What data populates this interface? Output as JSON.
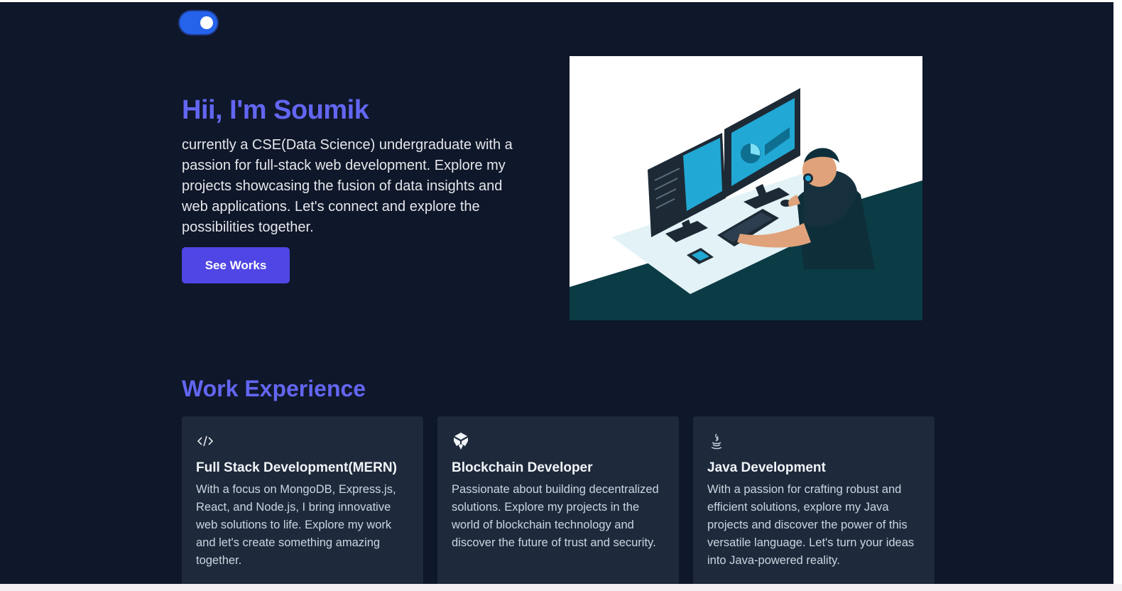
{
  "theme_toggle": {
    "state": "on"
  },
  "hero": {
    "title": "Hii, I'm Soumik",
    "description": "currently a CSE(Data Science) undergraduate with a passion for full-stack web development. Explore my projects showcasing the fusion of data insights and web applications. Let's connect and explore the possibilities together.",
    "button_label": "See Works"
  },
  "work": {
    "title": "Work Experience",
    "cards": [
      {
        "icon": "code-icon",
        "title": "Full Stack Development(MERN)",
        "text": "With a focus on MongoDB, Express.js, React, and Node.js, I bring innovative web solutions to life. Explore my work and let's create something amazing together."
      },
      {
        "icon": "blockchain-icon",
        "title": "Blockchain Developer",
        "text": "Passionate about building decentralized solutions. Explore my projects in the world of blockchain technology and discover the future of trust and security."
      },
      {
        "icon": "java-icon",
        "title": "Java Development",
        "text": "With a passion for crafting robust and efficient solutions, explore my Java projects and discover the power of this versatile language. Let's turn your ideas into Java-powered reality."
      }
    ]
  },
  "colors": {
    "background": "#0f172a",
    "accent": "#6366f1",
    "button": "#4f46e5",
    "card": "#1e293b",
    "toggle": "#2563eb"
  }
}
